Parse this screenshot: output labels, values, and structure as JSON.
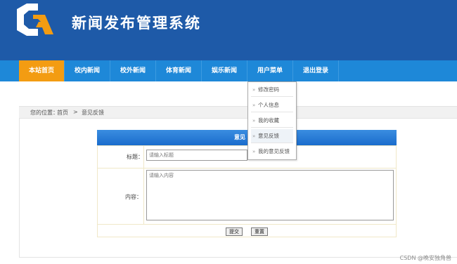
{
  "header": {
    "title": "新闻发布管理系统"
  },
  "nav": {
    "items": [
      {
        "label": "本站首页",
        "active": true
      },
      {
        "label": "校内新闻"
      },
      {
        "label": "校外新闻"
      },
      {
        "label": "体育新闻"
      },
      {
        "label": "娱乐新闻"
      },
      {
        "label": "用户菜单"
      },
      {
        "label": "退出登录"
      }
    ]
  },
  "dropdown": {
    "items": [
      "修改密码",
      "个人信息",
      "我的收藏",
      "意见反馈",
      "我的意见反馈"
    ],
    "hovered": "意见反馈"
  },
  "breadcrumb": {
    "prefix": "您的位置：",
    "home": "首页",
    "separator": ">",
    "current": "意见反馈"
  },
  "panel": {
    "title": "意见"
  },
  "form": {
    "title_label": "标题：",
    "title_placeholder": "请输入标题",
    "content_label": "内容：",
    "content_placeholder": "请输入内容",
    "submit_label": "提交",
    "reset_label": "重置"
  },
  "watermark": "CSDN @晚安独角兽",
  "colors": {
    "header": "#1e5aa8",
    "nav": "#1e88d8",
    "nav_active": "#f39c12",
    "logo_orange": "#f39c12"
  }
}
